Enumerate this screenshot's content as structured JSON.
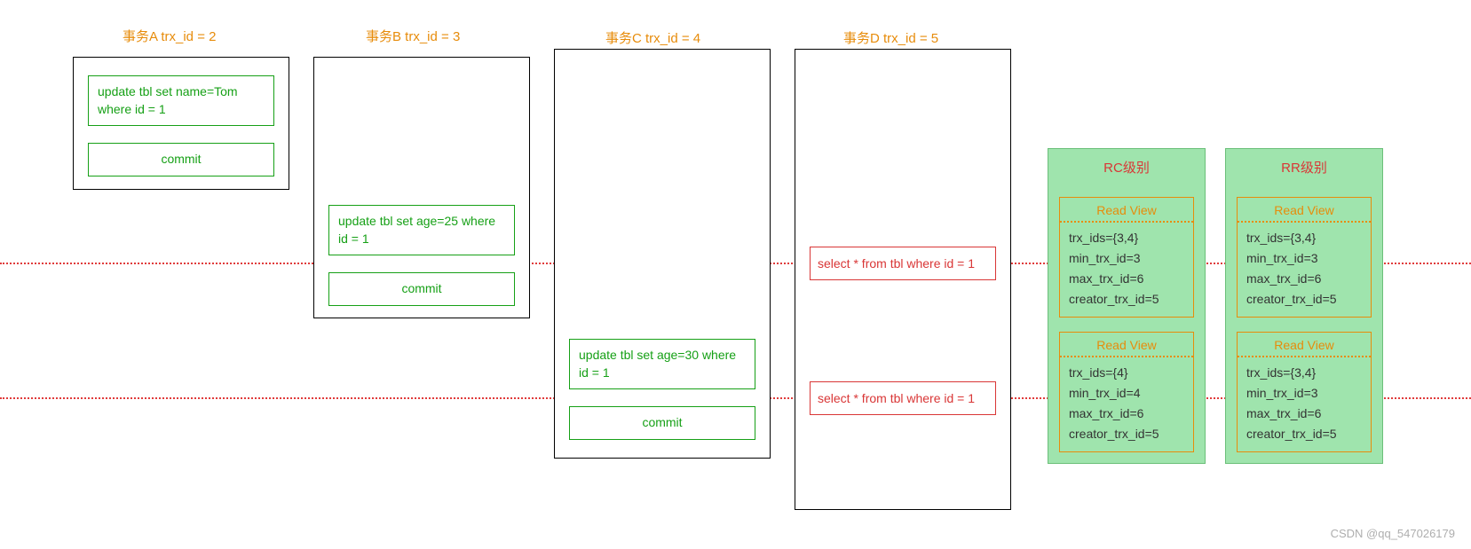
{
  "transactions": {
    "A": {
      "title": "事务A trx_id = 2",
      "update": "update tbl set name=Tom where id = 1",
      "commit": "commit"
    },
    "B": {
      "title": "事务B trx_id = 3",
      "update": "update tbl set age=25 where id = 1",
      "commit": "commit"
    },
    "C": {
      "title": "事务C trx_id = 4",
      "update": "update tbl set age=30 where id = 1",
      "commit": "commit"
    },
    "D": {
      "title": "事务D trx_id = 5",
      "select1": "select * from tbl where id = 1",
      "select2": "select * from tbl where id = 1"
    }
  },
  "levels": {
    "rc": {
      "title": "RC级别",
      "rv1": {
        "head": "Read View",
        "l1": "trx_ids={3,4}",
        "l2": "min_trx_id=3",
        "l3": "max_trx_id=6",
        "l4": "creator_trx_id=5"
      },
      "rv2": {
        "head": "Read View",
        "l1": "trx_ids={4}",
        "l2": "min_trx_id=4",
        "l3": "max_trx_id=6",
        "l4": "creator_trx_id=5"
      }
    },
    "rr": {
      "title": "RR级别",
      "rv1": {
        "head": "Read View",
        "l1": "trx_ids={3,4}",
        "l2": "min_trx_id=3",
        "l3": "max_trx_id=6",
        "l4": "creator_trx_id=5"
      },
      "rv2": {
        "head": "Read View",
        "l1": "trx_ids={3,4}",
        "l2": "min_trx_id=3",
        "l3": "max_trx_id=6",
        "l4": "creator_trx_id=5"
      }
    }
  },
  "watermark": "CSDN @qq_547026179"
}
